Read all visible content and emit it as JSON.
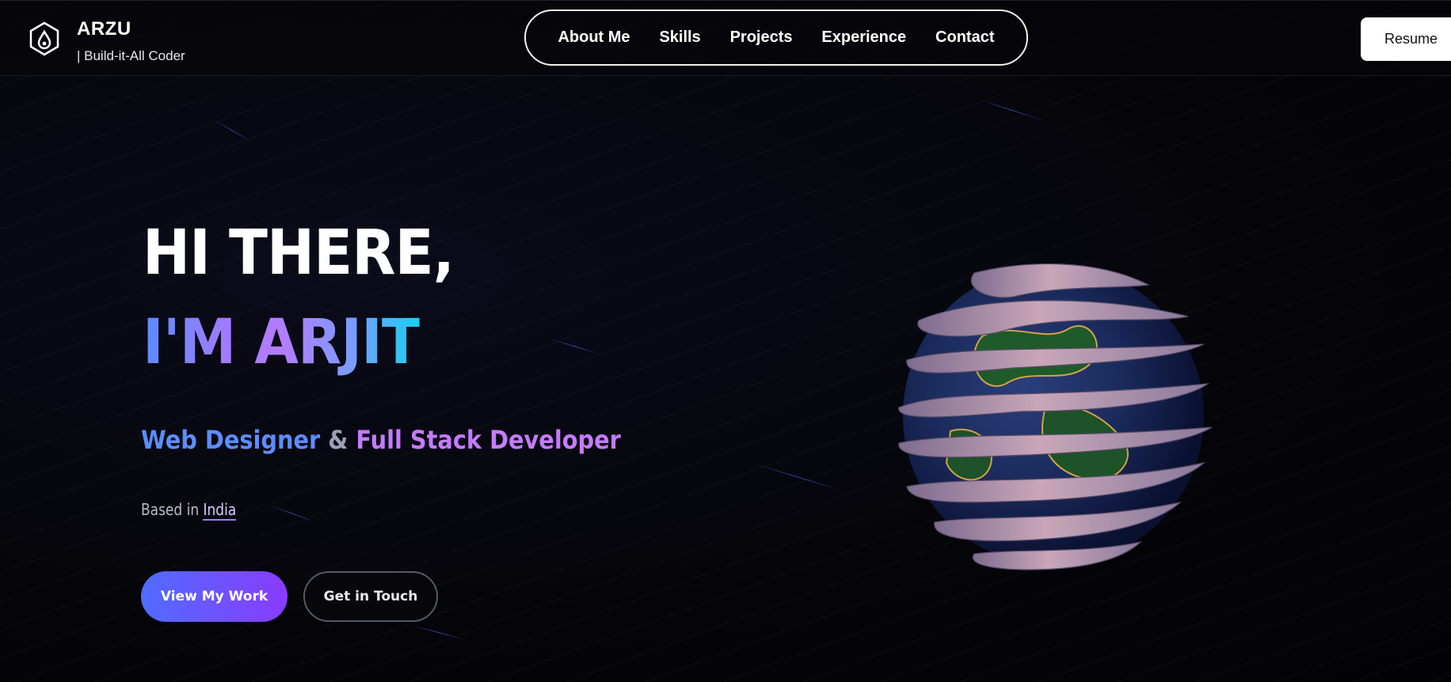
{
  "brand": {
    "name": "ARZU",
    "tagline": "| Build-it-All Coder"
  },
  "nav": {
    "links": [
      "About Me",
      "Skills",
      "Projects",
      "Experience",
      "Contact"
    ],
    "resume_label": "Resume"
  },
  "hero": {
    "greeting": "HI THERE,",
    "name_line": "I'M ARJIT",
    "role_primary": "Web Designer",
    "role_separator": "&",
    "role_secondary": "Full Stack Developer",
    "based_prefix": "Based in",
    "based_country": "India",
    "primary_cta": "View My Work",
    "secondary_cta": "Get in Touch"
  },
  "colors": {
    "accent_blue": "#5c8dff",
    "accent_purple": "#c57bff",
    "accent_cyan": "#18d0f0",
    "background": "#040409"
  },
  "icons": {
    "logo": "hexagon-drop-logo-icon",
    "hero_visual": "wrapped-globe-3d"
  }
}
